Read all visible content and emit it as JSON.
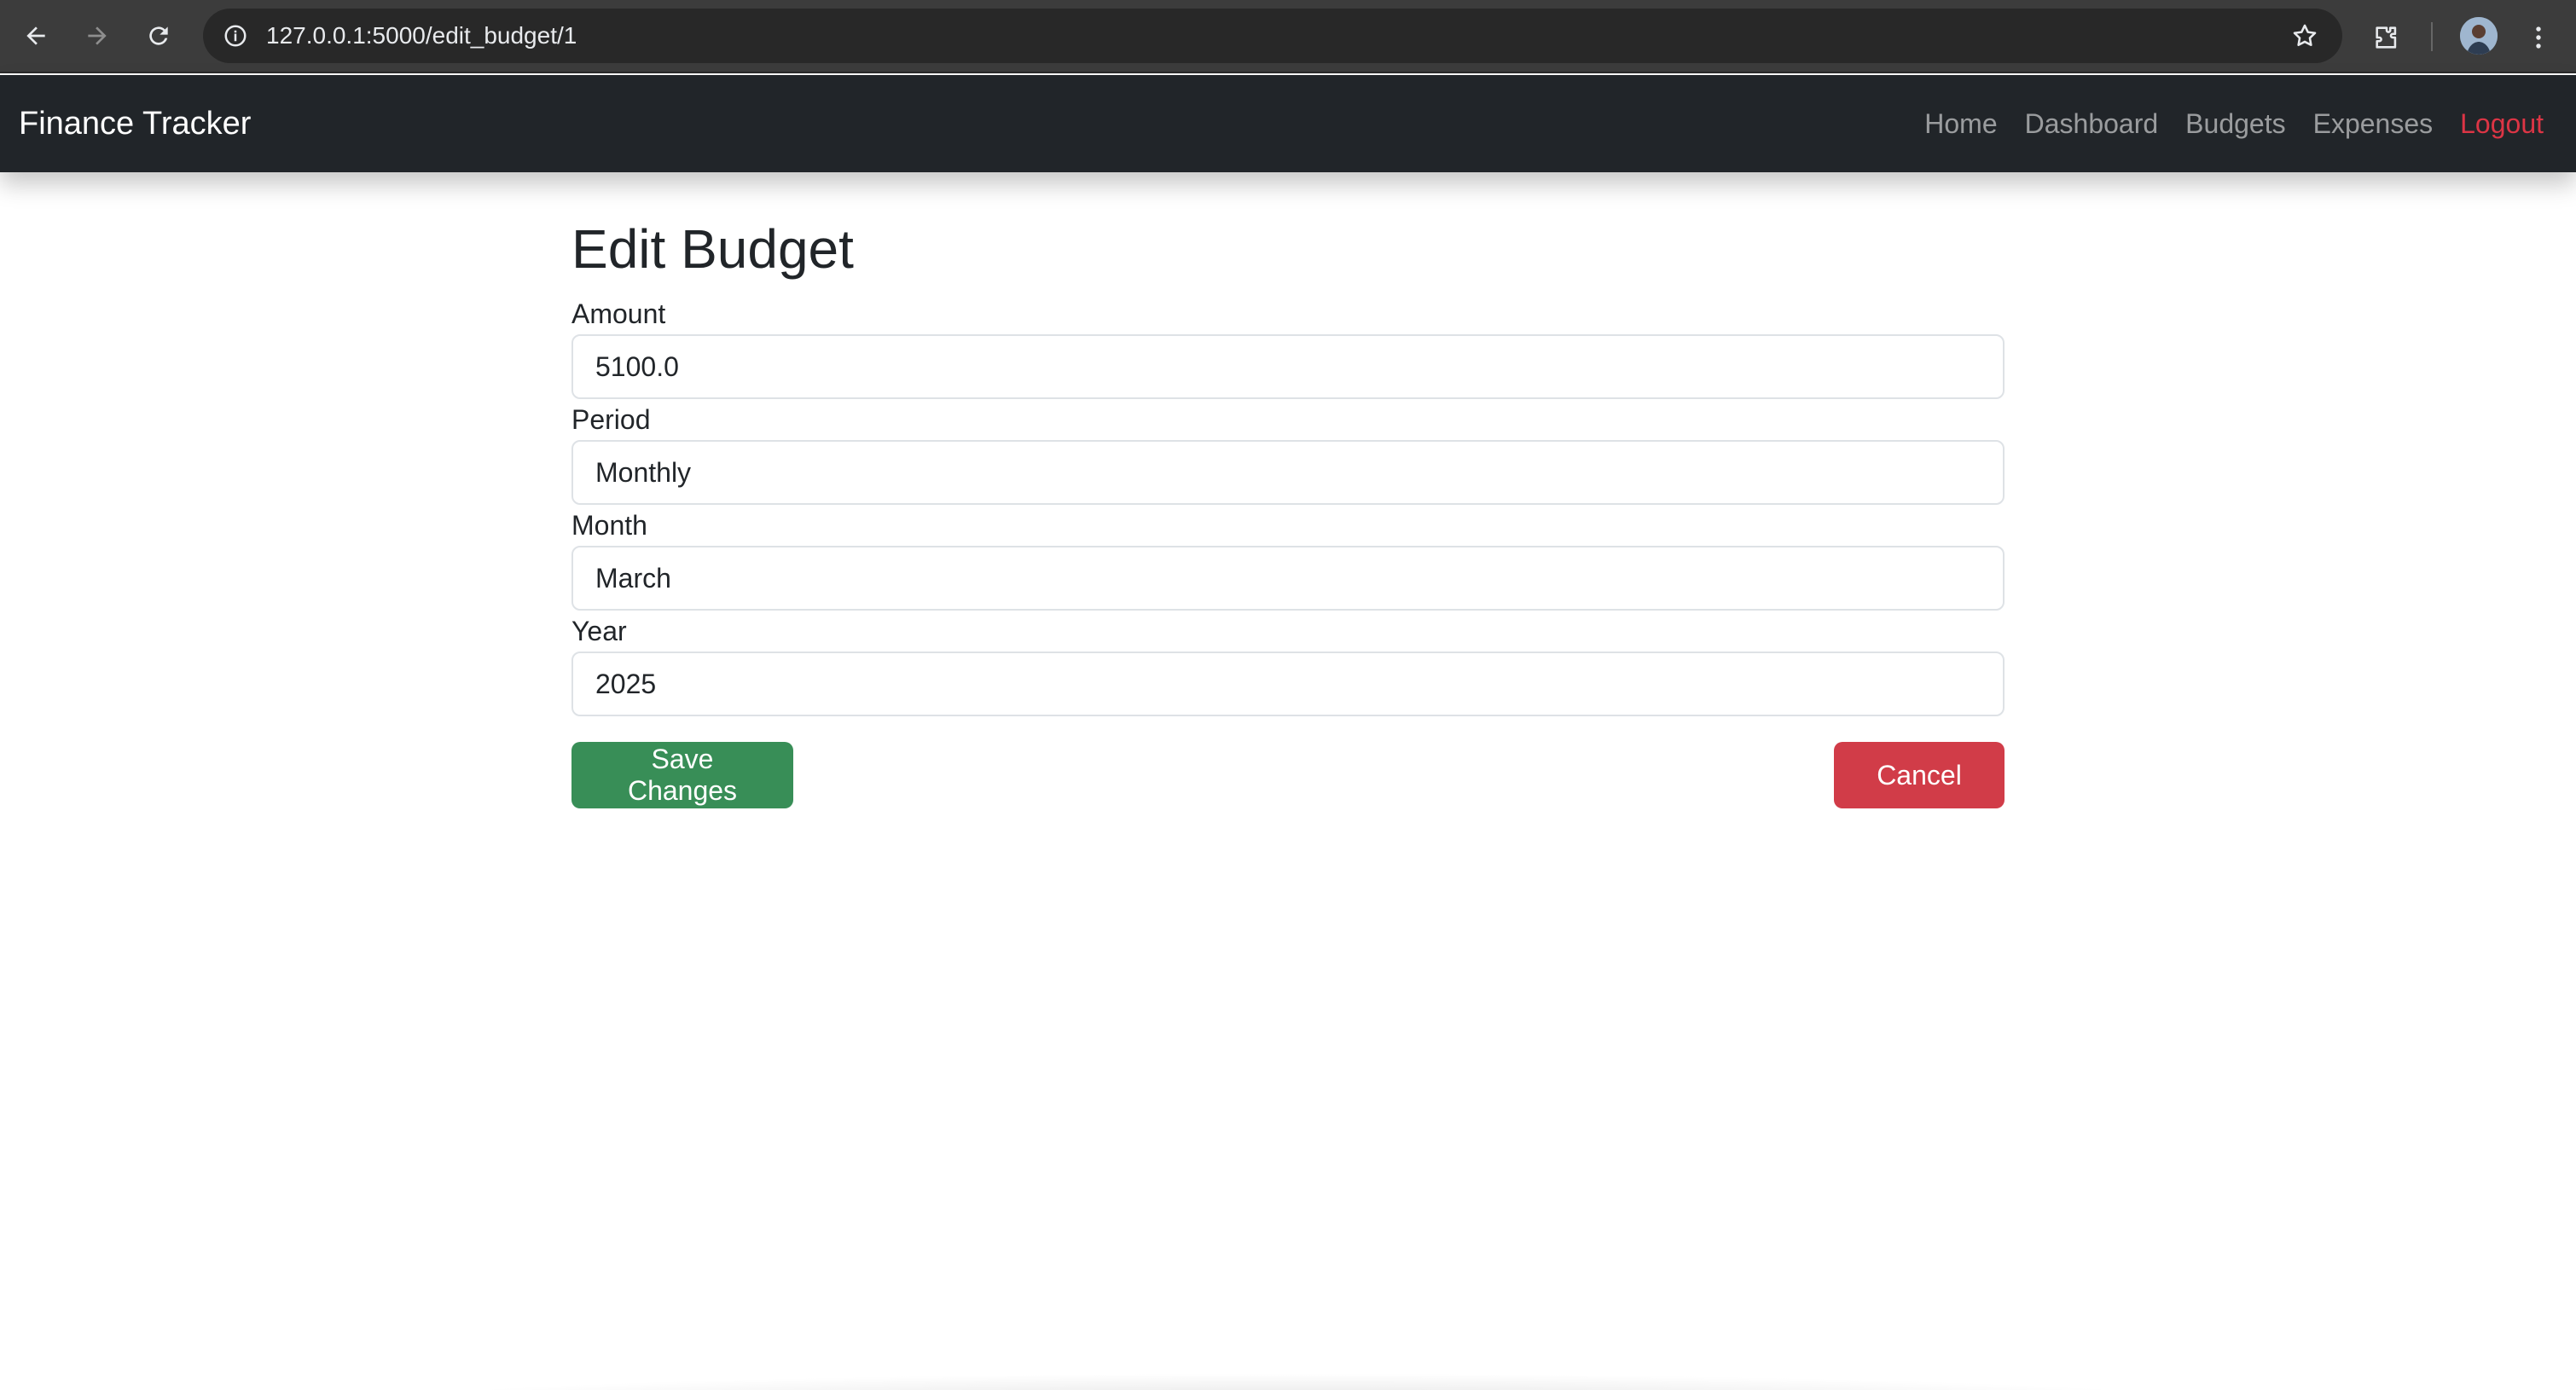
{
  "browser": {
    "url": "127.0.0.1:5000/edit_budget/1",
    "icons": [
      "back-icon",
      "forward-icon",
      "reload-icon",
      "info-icon",
      "star-icon",
      "extensions-icon",
      "avatar",
      "menu-icon"
    ]
  },
  "navbar": {
    "brand": "Finance Tracker",
    "links": [
      "Home",
      "Dashboard",
      "Budgets",
      "Expenses",
      "Logout"
    ],
    "logout_color": "#dc3545"
  },
  "form": {
    "title": "Edit Budget",
    "amount_label": "Amount",
    "amount_value": "5100.0",
    "period_label": "Period",
    "period_value": "Monthly",
    "month_label": "Month",
    "month_value": "March",
    "year_label": "Year",
    "year_value": "2025",
    "save_label": "Save Changes",
    "cancel_label": "Cancel"
  },
  "colors": {
    "navbar_bg": "#212529",
    "save_button": "#388e57",
    "cancel_button": "#d13c48"
  }
}
